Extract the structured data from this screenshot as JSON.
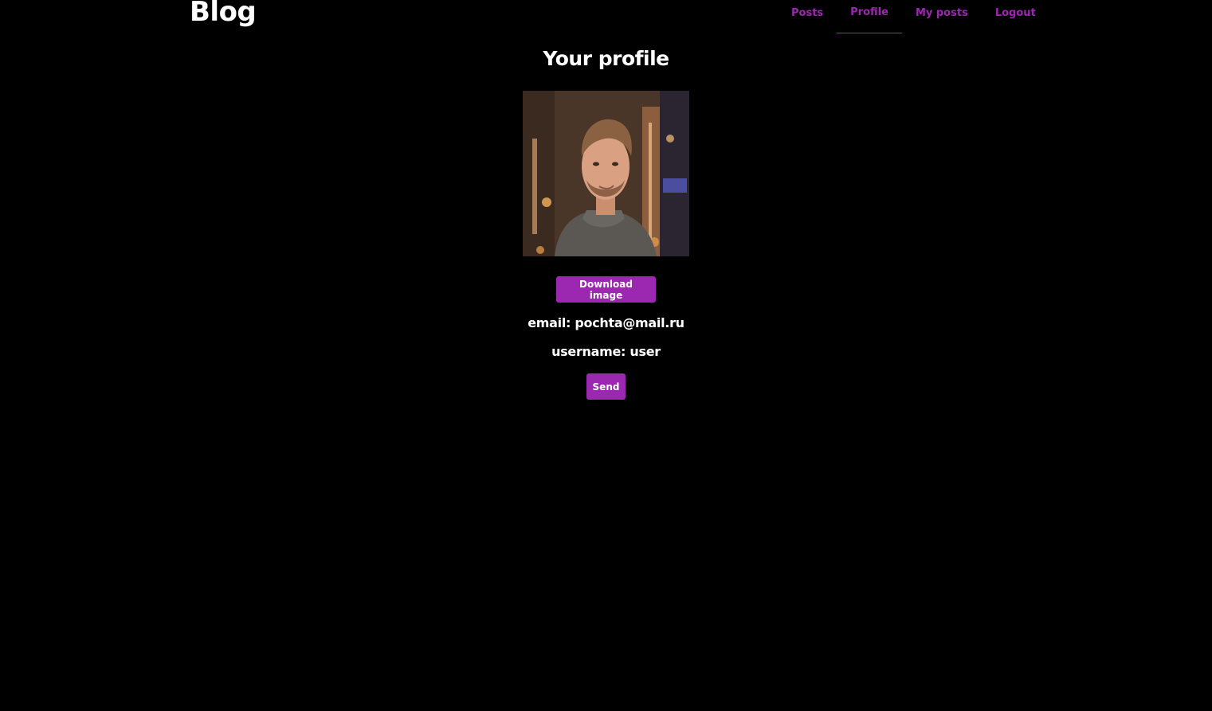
{
  "header": {
    "brand": "Blog",
    "nav": [
      {
        "label": "Posts",
        "active": false
      },
      {
        "label": "Profile",
        "active": true
      },
      {
        "label": "My posts",
        "active": false
      },
      {
        "label": "Logout",
        "active": false
      }
    ]
  },
  "main": {
    "title": "Your profile",
    "avatar_icon": "profile-photo",
    "download_button": "Download image",
    "email_line": "email: pochta@mail.ru",
    "username_line": "username: user",
    "send_button": "Send"
  },
  "colors": {
    "background": "#000000",
    "accent": "#9c27b0",
    "text": "#ffffff"
  }
}
